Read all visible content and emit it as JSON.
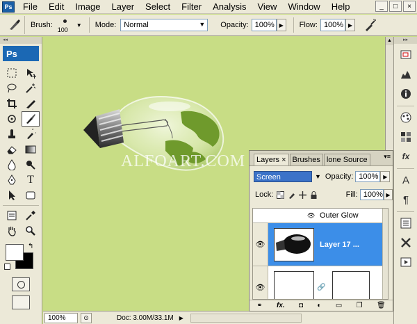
{
  "menubar": {
    "app_badge": "Ps",
    "items": [
      "File",
      "Edit",
      "Image",
      "Layer",
      "Select",
      "Filter",
      "Analysis",
      "View",
      "Window",
      "Help"
    ],
    "window_buttons": [
      "_",
      "□",
      "×"
    ]
  },
  "options": {
    "brush_label": "Brush:",
    "brush_size": "100",
    "mode_label": "Mode:",
    "mode_value": "Normal",
    "opacity_label": "Opacity:",
    "opacity_value": "100%",
    "flow_label": "Flow:",
    "flow_value": "100%"
  },
  "toolbox": {
    "logo": "Ps",
    "type_tool_glyph": "T"
  },
  "canvas": {
    "watermark": "ALFOART.COM",
    "background_color": "#c8dd85"
  },
  "status": {
    "zoom": "100%",
    "doc_info": "Doc: 3.00M/33.1M"
  },
  "dock": {
    "icons": [
      "navigator-icon",
      "histogram-icon",
      "info-icon",
      "color-icon",
      "swatches-icon",
      "styles-icon",
      "character-icon",
      "paragraph-icon",
      "actions-icon",
      "tools-presets-icon",
      "animation-icon"
    ],
    "character_glyph": "A",
    "paragraph_glyph": "¶",
    "styles_glyph": "fx"
  },
  "layers_panel": {
    "tabs": [
      "Layers ×",
      "Brushes",
      "lone Source"
    ],
    "blend_mode": "Screen",
    "opacity_label": "Opacity:",
    "opacity_value": "100%",
    "lock_label": "Lock:",
    "fill_label": "Fill:",
    "fill_value": "100%",
    "effect_name": "Outer Glow",
    "selected_layer_name": "Layer 17 ...",
    "bottom_icons": [
      "link-icon",
      "fx-icon",
      "mask-icon",
      "adjustment-icon",
      "group-icon",
      "new-layer-icon",
      "trash-icon"
    ],
    "bottom_fx": "fx."
  }
}
